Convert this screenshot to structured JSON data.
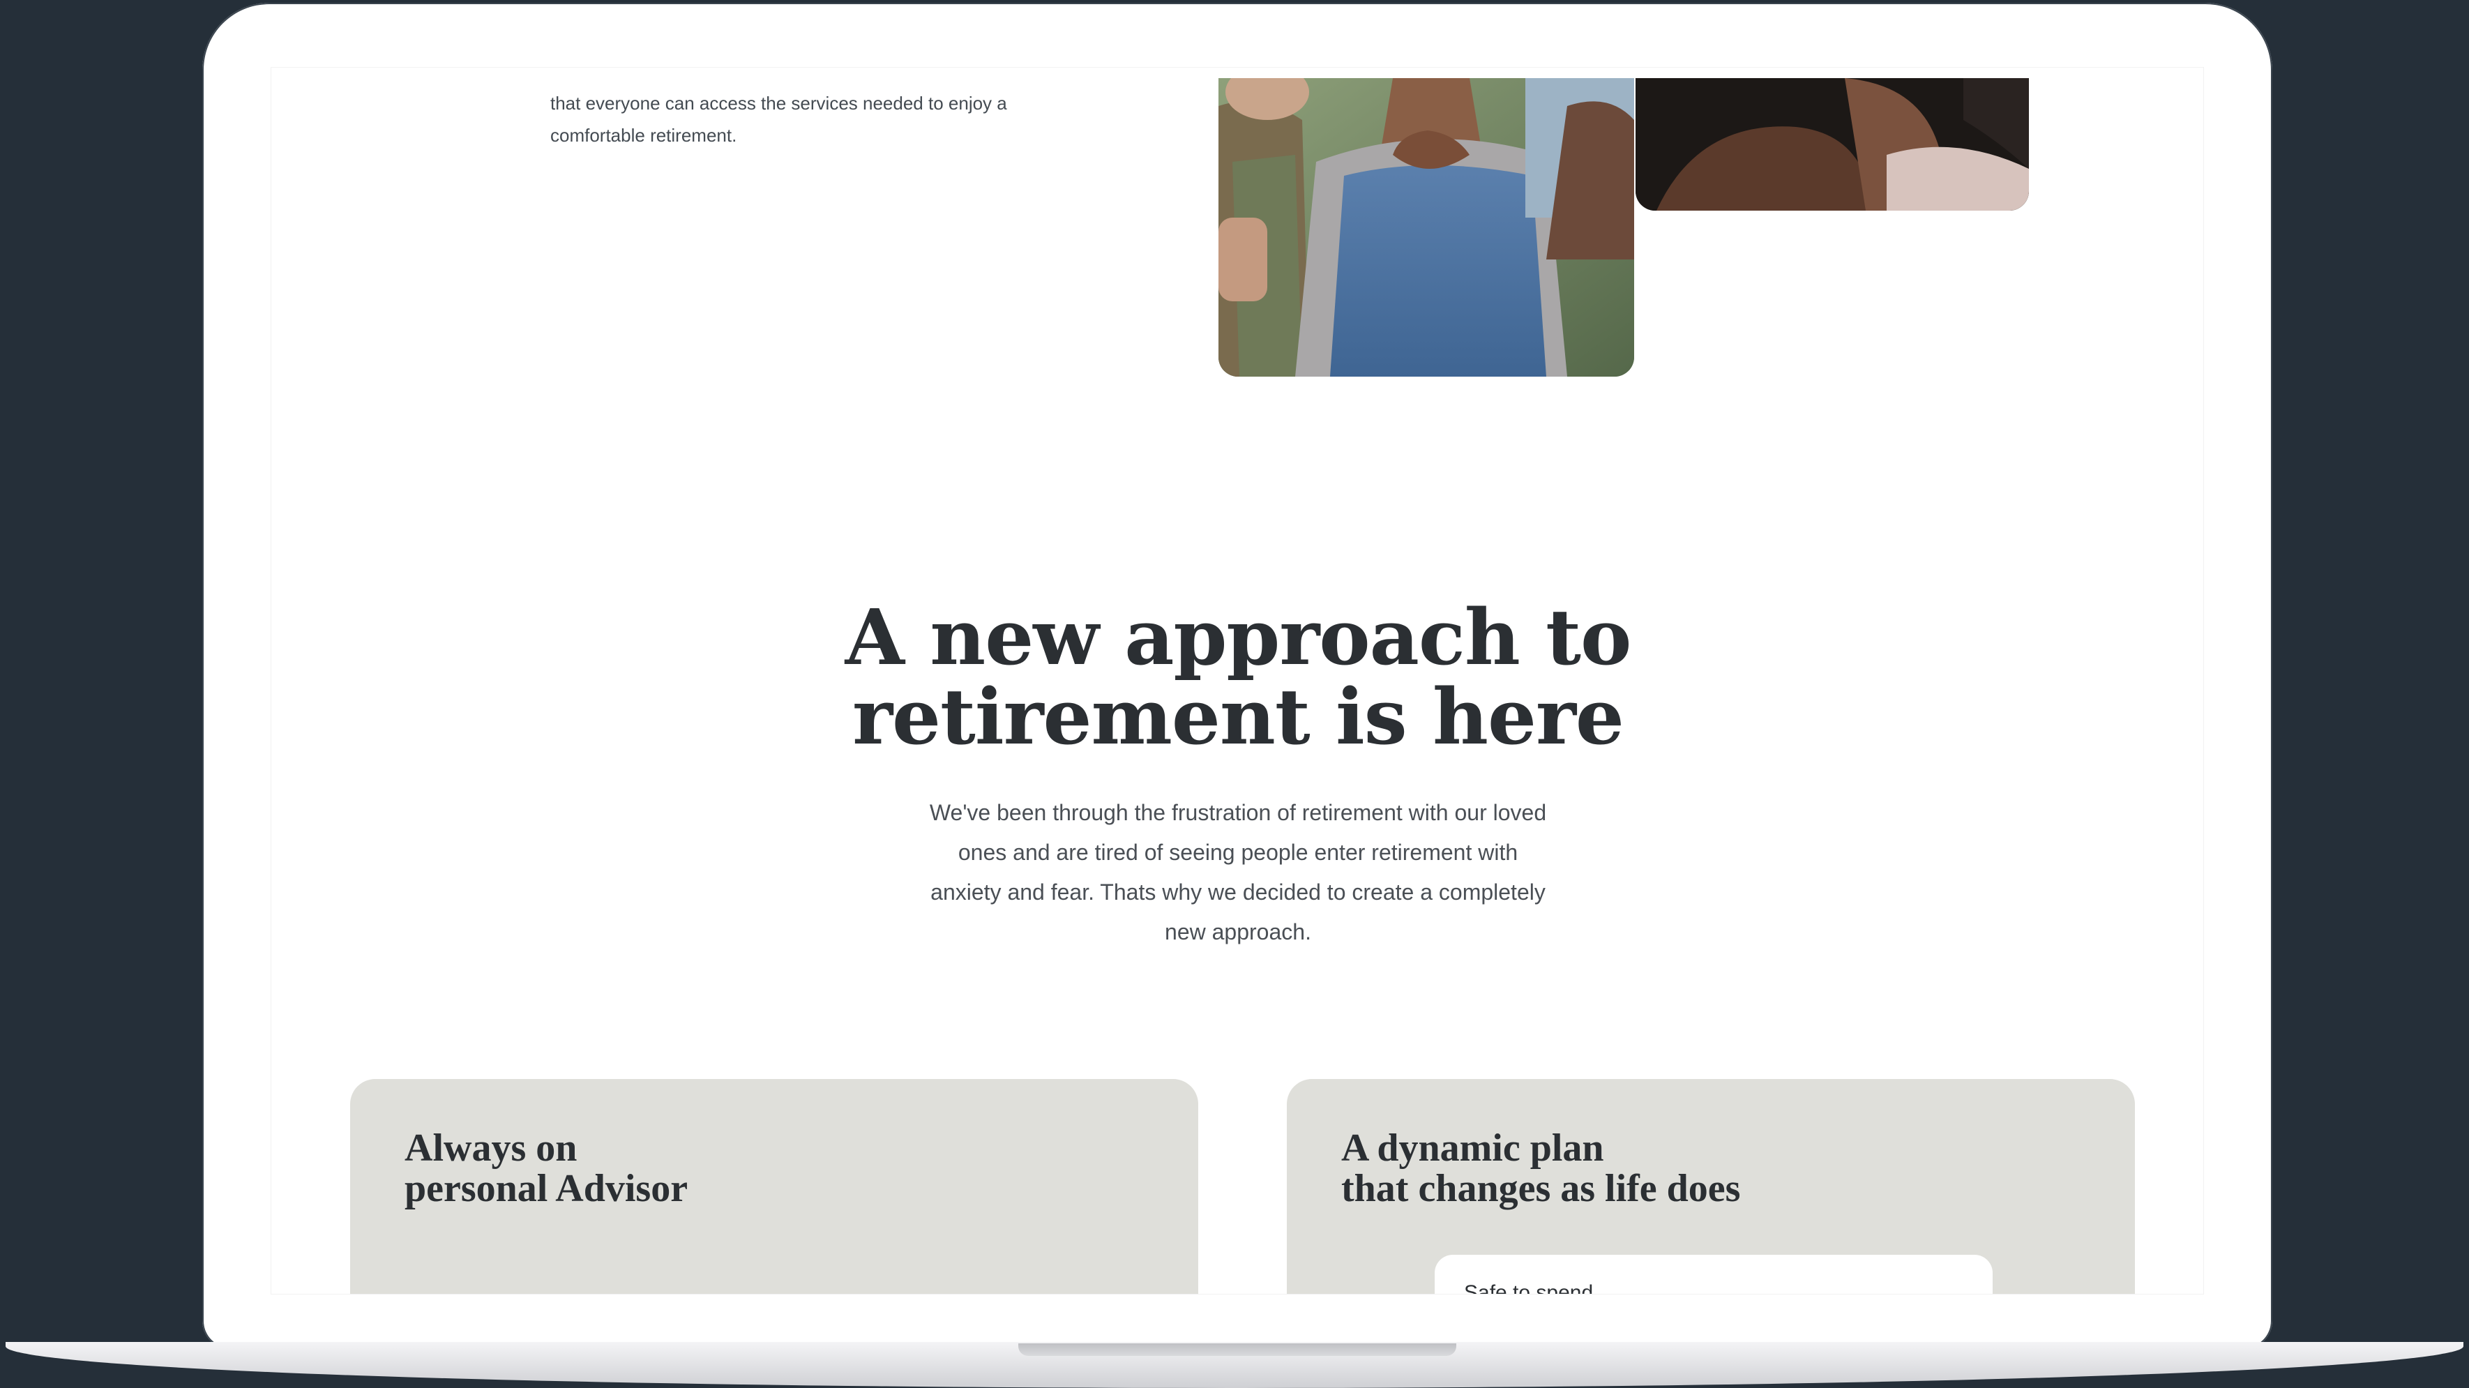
{
  "intro": {
    "lines": [
      "that everyone can access the services needed to enjoy a",
      "comfortable retirement."
    ]
  },
  "hero": {
    "title_line1": "A new approach to",
    "title_line2": "retirement is here",
    "description": "We've been through the frustration of retirement with our loved ones and are tired of seeing people enter retirement with anxiety and fear. Thats why we decided to create a completely new approach."
  },
  "cards": [
    {
      "title_line1": "Always on",
      "title_line2": "personal Advisor"
    },
    {
      "title_line1": "A dynamic plan",
      "title_line2": "that changes as life does",
      "inner_label": "Safe to spend"
    }
  ],
  "colors": {
    "background": "#252f39",
    "card": "#dfdfda",
    "heading": "#2b2f33",
    "body_text": "#4a4f55"
  }
}
